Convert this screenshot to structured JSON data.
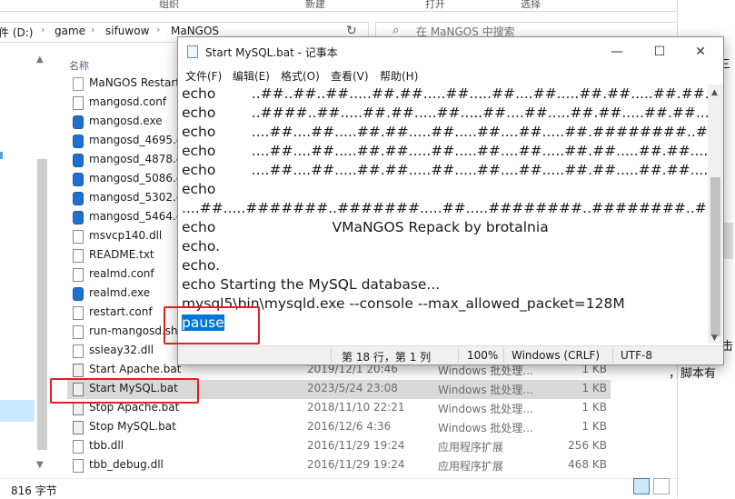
{
  "explorer": {
    "ribbon_groups": [
      "组织",
      "新建",
      "打开",
      "选择"
    ],
    "breadcrumbs": [
      "件 (D:)",
      "game",
      "sifuwow",
      "MaNGOS"
    ],
    "search_placeholder": "在 MaNGOS 中搜索",
    "column_name": "名称",
    "files": [
      {
        "name": "MaNGOS Restart",
        "date": "",
        "type": "",
        "size": "",
        "icon": "gear"
      },
      {
        "name": "mangosd.conf",
        "date": "",
        "type": "",
        "size": "",
        "icon": "file"
      },
      {
        "name": "mangosd.exe",
        "date": "",
        "type": "",
        "size": "",
        "icon": "exe"
      },
      {
        "name": "mangosd_4695.e",
        "date": "",
        "type": "",
        "size": "",
        "icon": "exe"
      },
      {
        "name": "mangosd_4878.e",
        "date": "",
        "type": "",
        "size": "",
        "icon": "exe"
      },
      {
        "name": "mangosd_5086.e",
        "date": "",
        "type": "",
        "size": "",
        "icon": "exe"
      },
      {
        "name": "mangosd_5302.e",
        "date": "",
        "type": "",
        "size": "",
        "icon": "exe"
      },
      {
        "name": "mangosd_5464.e",
        "date": "",
        "type": "",
        "size": "",
        "icon": "exe"
      },
      {
        "name": "msvcp140.dll",
        "date": "",
        "type": "",
        "size": "",
        "icon": "file"
      },
      {
        "name": "README.txt",
        "date": "",
        "type": "",
        "size": "",
        "icon": "file"
      },
      {
        "name": "realmd.conf",
        "date": "",
        "type": "",
        "size": "",
        "icon": "file"
      },
      {
        "name": "realmd.exe",
        "date": "",
        "type": "",
        "size": "",
        "icon": "exe"
      },
      {
        "name": "restart.conf",
        "date": "",
        "type": "",
        "size": "",
        "icon": "file"
      },
      {
        "name": "run-mangosd.sh",
        "date": "",
        "type": "",
        "size": "",
        "icon": "file"
      },
      {
        "name": "ssleay32.dll",
        "date": "",
        "type": "",
        "size": "",
        "icon": "file"
      },
      {
        "name": "Start Apache.bat",
        "date": "2019/12/1 20:46",
        "type": "Windows 批处理...",
        "size": "1 KB",
        "icon": "bat"
      },
      {
        "name": "Start MySQL.bat",
        "date": "2023/5/24 23:08",
        "type": "Windows 批处理...",
        "size": "1 KB",
        "icon": "bat"
      },
      {
        "name": "Stop Apache.bat",
        "date": "2018/11/10 22:21",
        "type": "Windows 批处理...",
        "size": "1 KB",
        "icon": "bat"
      },
      {
        "name": "Stop MySQL.bat",
        "date": "2016/12/6 4:36",
        "type": "Windows 批处理...",
        "size": "1 KB",
        "icon": "bat"
      },
      {
        "name": "tbb.dll",
        "date": "2016/11/29 19:24",
        "type": "应用程序扩展",
        "size": "256 KB",
        "icon": "file"
      },
      {
        "name": "tbb_debug.dll",
        "date": "2016/11/29 19:24",
        "type": "应用程序扩展",
        "size": "468 KB",
        "icon": "file"
      }
    ],
    "status": "816 字节",
    "right_fragments": [
      "三",
      "击",
      "，脚本有"
    ]
  },
  "notepad": {
    "title": "Start MySQL.bat - 记事本",
    "menus": [
      "文件(F)",
      "编辑(E)",
      "格式(O)",
      "查看(V)",
      "帮助(H)"
    ],
    "lines": [
      "echo        ..##..##..##.....##.##.....##.....##....##.....##.##.....##.##......",
      "echo        ..####..##.....##.##.....##.....##....##.....##.##.....##.##......",
      "echo        ....##....##.....##.##.....##.....##....##.....##.########..######..",
      "echo        ....##....##.....##.##.....##.....##....##.....##.##.....##.##......",
      "echo        ....##....##.....##.##.....##.....##....##.....##.##.....##.##......",
      "echo",
      "....##.....#######..#######.....##.....########..########..########",
      "echo                          VMaNGOS Repack by brotalnia",
      "echo.",
      "echo.",
      "echo Starting the MySQL database...",
      "mysql5\\bin\\mysqld.exe --console --max_allowed_packet=128M",
      "pause"
    ],
    "status": {
      "position": "第 18 行，第 1 列",
      "zoom": "100%",
      "line_ending": "Windows (CRLF)",
      "encoding": "UTF-8"
    }
  }
}
